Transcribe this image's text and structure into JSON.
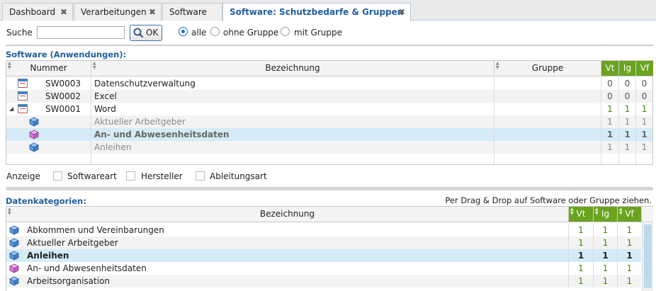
{
  "tabs": [
    {
      "label": "Dashboard",
      "close": "✖"
    },
    {
      "label": "Verarbeitungen",
      "close": "✖"
    },
    {
      "label": "Software",
      "close": ""
    },
    {
      "label": "Software: Schutzbedarfe & Gruppen",
      "close": "✖"
    }
  ],
  "search": {
    "label": "Suche",
    "value": "",
    "placeholder": "",
    "ok_label": "OK"
  },
  "filter": {
    "options": [
      "alle",
      "ohne Gruppe",
      "mit Gruppe"
    ],
    "selected": "alle"
  },
  "software": {
    "title": "Software (Anwendungen):",
    "columns": {
      "nummer": "Nummer",
      "bezeichnung": "Bezeichnung",
      "gruppe": "Gruppe",
      "vt": "Vt",
      "ig": "Ig",
      "vf": "Vf"
    },
    "rows": [
      {
        "nummer": "SW0003",
        "bezeichnung": "Datenschutzverwaltung",
        "gruppe": "",
        "vt": "0",
        "ig": "0",
        "vf": "0"
      },
      {
        "nummer": "SW0002",
        "bezeichnung": "Excel",
        "gruppe": "",
        "vt": "0",
        "ig": "0",
        "vf": "0"
      },
      {
        "nummer": "SW0001",
        "bezeichnung": "Word",
        "gruppe": "",
        "vt": "1",
        "ig": "1",
        "vf": "1"
      }
    ],
    "children": [
      {
        "bezeichnung": "Aktueller Arbeitgeber",
        "vt": "1",
        "ig": "1",
        "vf": "1"
      },
      {
        "bezeichnung": "An- und Abwesenheitsdaten",
        "vt": "1",
        "ig": "1",
        "vf": "1"
      },
      {
        "bezeichnung": "Anleihen",
        "vt": "1",
        "ig": "1",
        "vf": "1"
      }
    ]
  },
  "anzeige": {
    "label": "Anzeige",
    "options": [
      "Softwareart",
      "Hersteller",
      "Ableitungsart"
    ]
  },
  "datenkategorien": {
    "title": "Datenkategorien:",
    "hint": "Per Drag & Drop auf Software oder Gruppe ziehen.",
    "columns": {
      "bezeichnung": "Bezeichnung",
      "vt": "Vt",
      "ig": "Ig",
      "vf": "Vf"
    },
    "rows": [
      {
        "bezeichnung": "Abkommen und Vereinbarungen",
        "vt": "1",
        "ig": "1",
        "vf": "1"
      },
      {
        "bezeichnung": "Aktueller Arbeitgeber",
        "vt": "1",
        "ig": "1",
        "vf": "1"
      },
      {
        "bezeichnung": "Anleihen",
        "vt": "1",
        "ig": "1",
        "vf": "1"
      },
      {
        "bezeichnung": "An- und Abwesenheitsdaten",
        "vt": "1",
        "ig": "1",
        "vf": "1"
      },
      {
        "bezeichnung": "Arbeitsorganisation",
        "vt": "1",
        "ig": "1",
        "vf": "1"
      }
    ]
  },
  "colors": {
    "accent": "#1f5fa0",
    "green": "#6aa31f",
    "selection": "#d5ebf7"
  }
}
